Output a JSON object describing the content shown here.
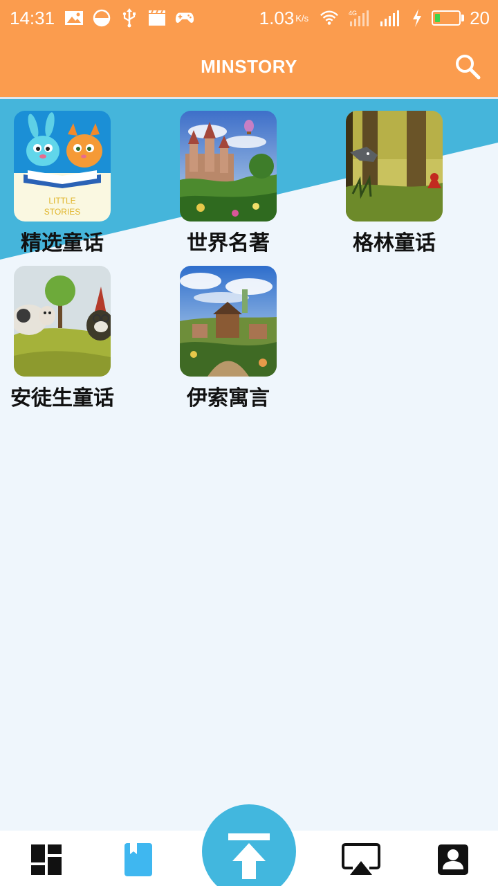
{
  "status_bar": {
    "time": "14:31",
    "net_speed": "1.03",
    "net_speed_unit": "K/s",
    "battery_level": "20",
    "battery_fraction": 0.2,
    "icons": [
      "gallery-icon",
      "data-saver-icon",
      "usb-icon",
      "clapper-icon",
      "gamepad-icon",
      "wifi-icon",
      "4g-signal-icon",
      "signal-icon",
      "charging-icon",
      "battery-icon"
    ]
  },
  "app_bar": {
    "title": "MINSTORY",
    "search_icon": "search-icon"
  },
  "books": [
    {
      "label": "精选童话",
      "cover_text_1": "LITTLE",
      "cover_text_2": "STORIES"
    },
    {
      "label": "世界名著"
    },
    {
      "label": "格林童话"
    },
    {
      "label": "安徒生童话"
    },
    {
      "label": "伊索寓言"
    }
  ],
  "bottom_nav": {
    "items": [
      {
        "icon": "dashboard-icon",
        "active": false
      },
      {
        "icon": "bookmark-icon",
        "active": true
      },
      {
        "icon": "upload-icon",
        "active": false
      },
      {
        "icon": "airplay-icon",
        "active": false
      },
      {
        "icon": "contact-icon",
        "active": false
      }
    ]
  },
  "colors": {
    "app_bar": "#FB9C4E",
    "accent_blue": "#42B7DE",
    "background": "#EFF6FC",
    "battery_green": "#3FD34B"
  }
}
